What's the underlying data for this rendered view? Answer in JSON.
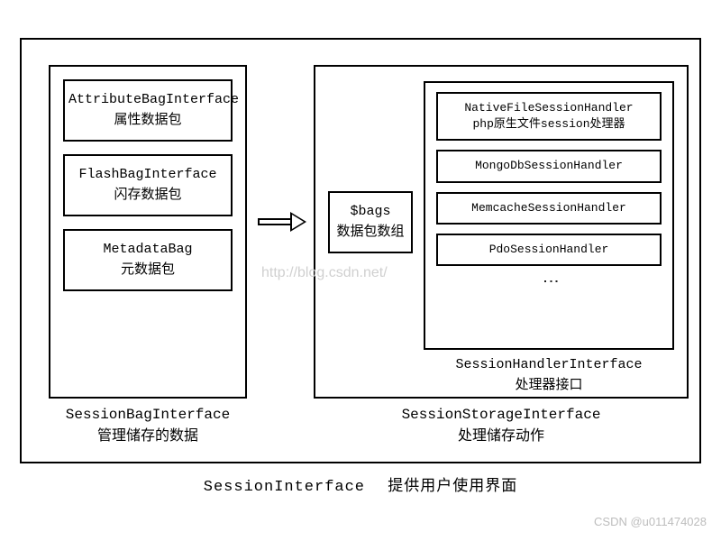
{
  "outer": {
    "title": "SessionInterface",
    "subtitle": "提供用户使用界面"
  },
  "left": {
    "caption_title": "SessionBagInterface",
    "caption_sub": "管理储存的数据",
    "items": [
      {
        "title": "AttributeBagInterface",
        "sub": "属性数据包"
      },
      {
        "title": "FlashBagInterface",
        "sub": "闪存数据包"
      },
      {
        "title": "MetadataBag",
        "sub": "元数据包"
      }
    ]
  },
  "right": {
    "caption_title": "SessionStorageInterface",
    "caption_sub": "处理储存动作",
    "bags": {
      "title": "$bags",
      "sub": "数据包数组"
    },
    "handler": {
      "caption_title": "SessionHandlerInterface",
      "caption_sub": "处理器接口",
      "items": [
        {
          "title": "NativeFileSessionHandler",
          "sub": "php原生文件session处理器"
        },
        {
          "title": "MongoDbSessionHandler",
          "sub": ""
        },
        {
          "title": "MemcacheSessionHandler",
          "sub": ""
        },
        {
          "title": "PdoSessionHandler",
          "sub": ""
        }
      ]
    }
  },
  "watermark": "http://blog.csdn.net/",
  "footer": "CSDN @u011474028"
}
